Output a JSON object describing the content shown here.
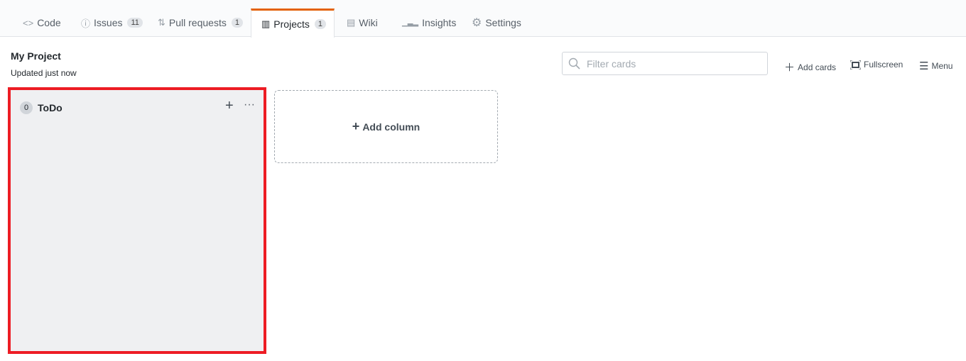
{
  "tabs": [
    {
      "label": "Code",
      "icon": "code-icon",
      "glyph": "<>"
    },
    {
      "label": "Issues",
      "icon": "issue-icon",
      "glyph": "ⓘ",
      "count": "11"
    },
    {
      "label": "Pull requests",
      "icon": "pull-request-icon",
      "glyph": "⇅",
      "count": "1"
    },
    {
      "label": "Projects",
      "icon": "project-icon",
      "glyph": "▥",
      "count": "1",
      "active": true
    },
    {
      "label": "Wiki",
      "icon": "book-icon",
      "glyph": "▤"
    },
    {
      "label": "Insights",
      "icon": "graph-icon",
      "glyph": "▁▃▂"
    },
    {
      "label": "Settings",
      "icon": "gear-icon",
      "glyph": "⚙"
    }
  ],
  "project": {
    "title": "My Project",
    "updated": "Updated just now"
  },
  "toolbar": {
    "filter_placeholder": "Filter cards",
    "filter_value": "",
    "add_cards": "Add cards",
    "fullscreen": "Fullscreen",
    "menu": "Menu"
  },
  "columns": [
    {
      "name": "ToDo",
      "count": "0"
    }
  ],
  "add_column": "Add column",
  "colors": {
    "accent": "#e36209",
    "highlight": "#ed1c24",
    "column_bg": "#eff0f2"
  }
}
